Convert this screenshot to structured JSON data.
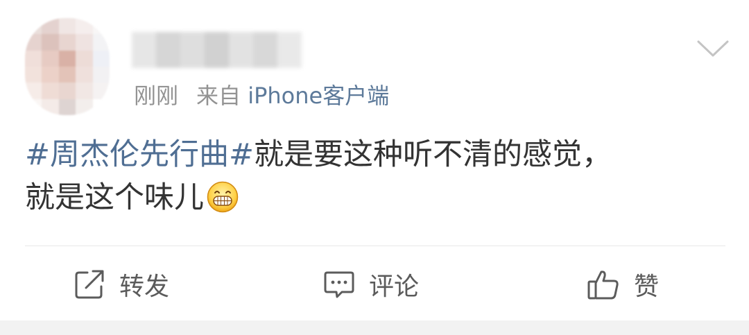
{
  "post": {
    "time": "刚刚",
    "source_prefix": "来自",
    "source_app": "iPhone客户端",
    "topic": "#周杰伦先行曲#",
    "text_line1": "就是要这种听不清的感觉，",
    "text_line2": "就是这个味儿",
    "emoji": "grinning-face-emoji"
  },
  "actions": {
    "repost_label": "转发",
    "comment_label": "评论",
    "like_label": "赞"
  },
  "icons": {
    "more": "chevron-down-icon",
    "repost": "share-out-icon",
    "comment": "comment-bubble-icon",
    "like": "thumbs-up-icon"
  },
  "colors": {
    "topic_link": "#4f6e93",
    "source_app": "#5d7a9a",
    "meta_gray": "#939393",
    "body_text": "#333333",
    "action_text": "#5b5b5b"
  }
}
